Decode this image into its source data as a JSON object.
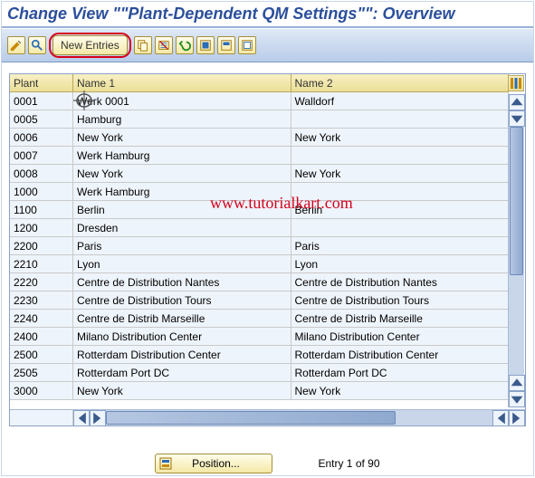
{
  "title": "Change View \"\"Plant-Dependent QM Settings\"\": Overview",
  "toolbar": {
    "new_entries_label": "New Entries"
  },
  "columns": {
    "plant": "Plant",
    "name1": "Name 1",
    "name2": "Name 2"
  },
  "rows": [
    {
      "plant": "0001",
      "name1": "Werk 0001",
      "name2": "Walldorf"
    },
    {
      "plant": "0005",
      "name1": "Hamburg",
      "name2": ""
    },
    {
      "plant": "0006",
      "name1": "New York",
      "name2": "New York"
    },
    {
      "plant": "0007",
      "name1": "Werk Hamburg",
      "name2": ""
    },
    {
      "plant": "0008",
      "name1": "New York",
      "name2": "New York"
    },
    {
      "plant": "1000",
      "name1": "Werk Hamburg",
      "name2": ""
    },
    {
      "plant": "1100",
      "name1": "Berlin",
      "name2": "Berlin"
    },
    {
      "plant": "1200",
      "name1": "Dresden",
      "name2": ""
    },
    {
      "plant": "2200",
      "name1": "Paris",
      "name2": "Paris"
    },
    {
      "plant": "2210",
      "name1": "Lyon",
      "name2": "Lyon"
    },
    {
      "plant": "2220",
      "name1": "Centre de Distribution Nantes",
      "name2": "Centre de Distribution Nantes"
    },
    {
      "plant": "2230",
      "name1": "Centre de Distribution Tours",
      "name2": "Centre de Distribution Tours"
    },
    {
      "plant": "2240",
      "name1": "Centre de Distrib  Marseille",
      "name2": "Centre de Distrib  Marseille"
    },
    {
      "plant": "2400",
      "name1": "Milano Distribution Center",
      "name2": "Milano Distribution Center"
    },
    {
      "plant": "2500",
      "name1": "Rotterdam Distribution Center",
      "name2": "Rotterdam Distribution Center"
    },
    {
      "plant": "2505",
      "name1": "Rotterdam Port DC",
      "name2": "Rotterdam Port DC"
    },
    {
      "plant": "3000",
      "name1": "New York",
      "name2": "New York"
    }
  ],
  "watermark": "www.tutorialkart.com",
  "footer": {
    "position_label": "Position...",
    "entry_label": "Entry 1 of 90"
  }
}
